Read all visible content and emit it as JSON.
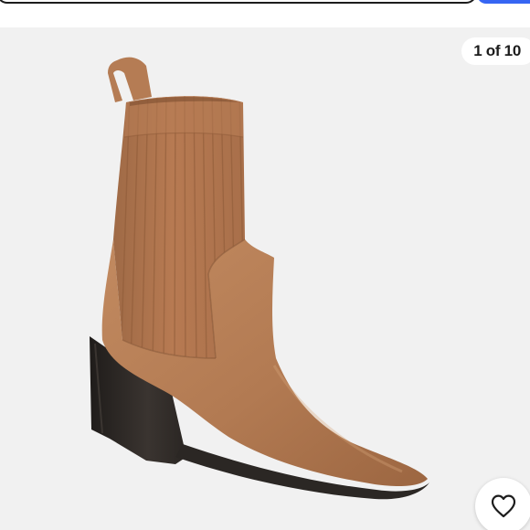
{
  "gallery": {
    "counter_text": "1 of 10",
    "current_image": 1,
    "total_images": 10
  },
  "icons": {
    "watch": "heart-icon"
  },
  "colors": {
    "search_button": "#3665f3",
    "gallery_background": "#f1f1f1",
    "boot_leather": "#b27a52",
    "boot_knit": "#b5774f",
    "heel": "#2b2724"
  }
}
